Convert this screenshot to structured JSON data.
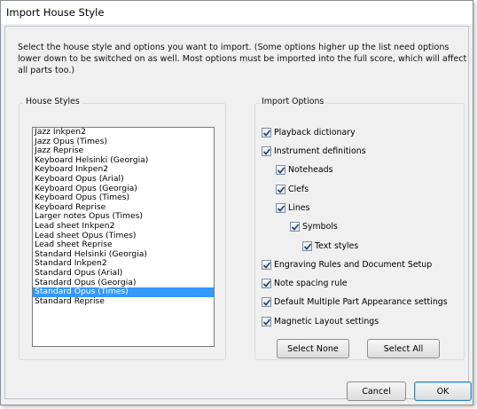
{
  "window": {
    "title": "Import House Style"
  },
  "intro_text": "Select the house style and options you want to import. (Some options higher up the list need options lower down to be switched on as well. Most options must be imported into the full score, which will affect all parts too.)",
  "house_styles": {
    "label": "House Styles",
    "items": [
      "Jazz Inkpen2",
      "Jazz Opus (Times)",
      "Jazz Reprise",
      "Keyboard Helsinki (Georgia)",
      "Keyboard Inkpen2",
      "Keyboard Opus (Arial)",
      "Keyboard Opus (Georgia)",
      "Keyboard Opus (Times)",
      "Keyboard Reprise",
      "Larger notes Opus (Times)",
      "Lead sheet Inkpen2",
      "Lead sheet Opus (Times)",
      "Lead sheet Reprise",
      "Standard Helsinki (Georgia)",
      "Standard Inkpen2",
      "Standard Opus (Arial)",
      "Standard Opus (Georgia)",
      "Standard Opus (Times)",
      "Standard Reprise"
    ],
    "selected": "Standard Opus (Times)"
  },
  "import_options": {
    "label": "Import Options",
    "options": [
      {
        "label": "Playback dictionary",
        "checked": true
      },
      {
        "label": "Instrument definitions",
        "checked": true
      },
      {
        "label": "Noteheads",
        "checked": true
      },
      {
        "label": "Clefs",
        "checked": true
      },
      {
        "label": "Lines",
        "checked": true
      },
      {
        "label": "Symbols",
        "checked": true
      },
      {
        "label": "Text styles",
        "checked": true
      },
      {
        "label": "Engraving Rules and Document Setup",
        "checked": true
      },
      {
        "label": "Note spacing rule",
        "checked": true
      },
      {
        "label": "Default Multiple Part Appearance settings",
        "checked": true
      },
      {
        "label": "Magnetic Layout settings",
        "checked": true
      }
    ],
    "select_none_label": "Select None",
    "select_all_label": "Select All"
  },
  "buttons": {
    "cancel": "Cancel",
    "ok": "OK"
  },
  "colors": {
    "selection": "#3399ff",
    "dialog_bg": "#f0f0f0",
    "checkmark": "#2c3e60"
  }
}
